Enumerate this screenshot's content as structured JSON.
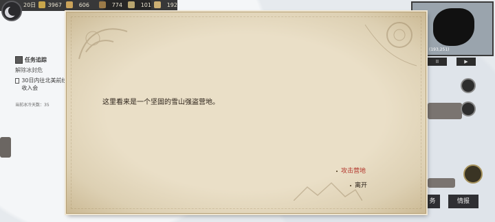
{
  "hud": {
    "day": "20日",
    "resources": [
      {
        "icon": "gold-icon",
        "value": "3967",
        "color": "#c9a64b"
      },
      {
        "icon": "grain-icon",
        "value": "606",
        "color": "#caa35a"
      },
      {
        "icon": "wood-icon",
        "value": "774",
        "color": "#9b7a48"
      },
      {
        "icon": "stone-icon",
        "value": "101",
        "color": "#b8a46e"
      },
      {
        "icon": "supply-icon",
        "value": "192",
        "color": "#cdb073"
      }
    ]
  },
  "task_panel": {
    "header": "任务追踪",
    "line1": "解除冰封危",
    "sub_item": "30日内往北美前线 收入会",
    "footer": "当前冰冷天数：35"
  },
  "minimap": {
    "coord": "(193,251)",
    "btn_pause": "II",
    "btn_play": "▶"
  },
  "dialog": {
    "narration": "这里看来是一个坚固的雪山强盗营地。",
    "choices": {
      "attack": "攻击营地",
      "leave": "离开"
    }
  },
  "bottom_buttons": {
    "task_fragment": "务",
    "intel": "情报"
  }
}
